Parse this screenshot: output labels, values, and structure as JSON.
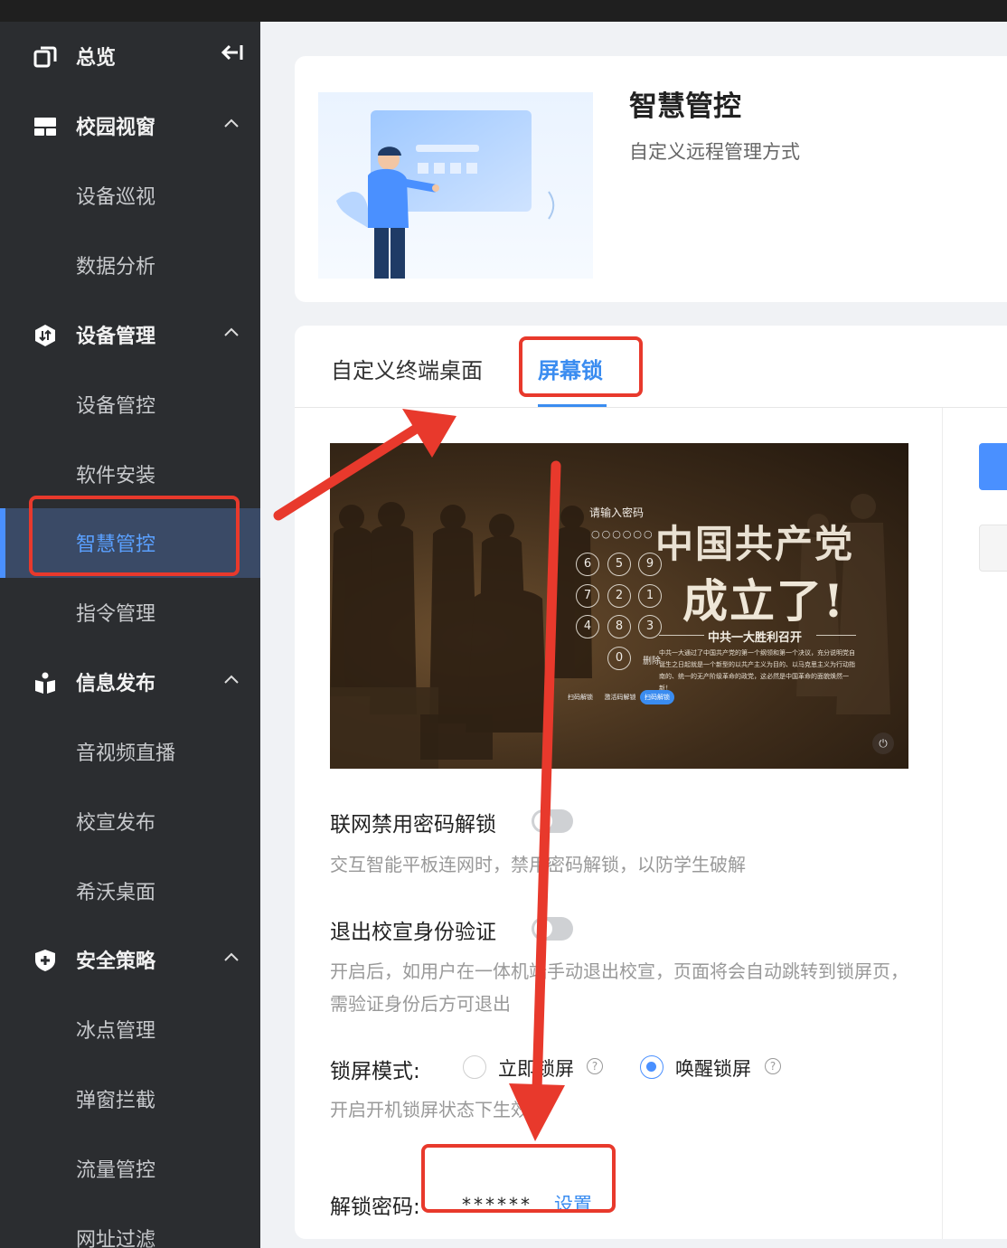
{
  "sidebar": {
    "overview": "总览",
    "groups": [
      {
        "label": "校园视窗",
        "icon": "dashboard-icon",
        "items": [
          "设备巡视",
          "数据分析"
        ]
      },
      {
        "label": "设备管理",
        "icon": "device-manage-icon",
        "items": [
          "设备管控",
          "软件安装",
          "智慧管控",
          "指令管理"
        ]
      },
      {
        "label": "信息发布",
        "icon": "publish-icon",
        "items": [
          "音视频直播",
          "校宣发布",
          "希沃桌面"
        ]
      },
      {
        "label": "安全策略",
        "icon": "shield-plus-icon",
        "items": [
          "冰点管理",
          "弹窗拦截",
          "流量管控",
          "网址过滤"
        ]
      }
    ],
    "active_item": "智慧管控"
  },
  "header": {
    "title": "智慧管控",
    "subtitle": "自定义远程管理方式"
  },
  "tabs": [
    {
      "label": "自定义终端桌面",
      "active": false
    },
    {
      "label": "屏幕锁",
      "active": true
    }
  ],
  "preview": {
    "prompt": "请输入密码",
    "dots": "○○○○○○",
    "keys": [
      "6",
      "5",
      "9",
      "7",
      "2",
      "1",
      "4",
      "8",
      "3",
      "0"
    ],
    "delete": "删除",
    "headline_1": "中国共产党",
    "headline_2": "成立了!",
    "news_title": "中共一大胜利召开",
    "news_body": "中共一大通过了中国共产党的第一个纲领和第一个决议，充分说明党自诞生之日起就是一个新型的以共产主义为目的、以马克思主义为行动指南的、统一的无产阶级革命的政党，这必然是中国革命的面貌焕然一新！",
    "mini_tabs": [
      "扫码解锁",
      "激活码解锁",
      "扫码解锁"
    ]
  },
  "settings": {
    "net_disable": {
      "label": "联网禁用密码解锁",
      "desc": "交互智能平板连网时，禁用密码解锁，以防学生破解",
      "enabled": false
    },
    "exit_verify": {
      "label": "退出校宣身份验证",
      "desc": "开启后，如用户在一体机端手动退出校宣，页面将会自动跳转到锁屏页，需验证身份后方可退出",
      "enabled": false
    },
    "lock_mode": {
      "label": "锁屏模式:",
      "options": [
        "立即锁屏",
        "唤醒锁屏"
      ],
      "selected": "唤醒锁屏",
      "desc": "开启开机锁屏状态下生效"
    },
    "unlock_password": {
      "label": "解锁密码:",
      "masked": "******",
      "action": "设置"
    }
  },
  "colors": {
    "accent": "#3a8cf0",
    "sidebar_bg": "#2b2d30",
    "annotation": "#e8392c"
  }
}
